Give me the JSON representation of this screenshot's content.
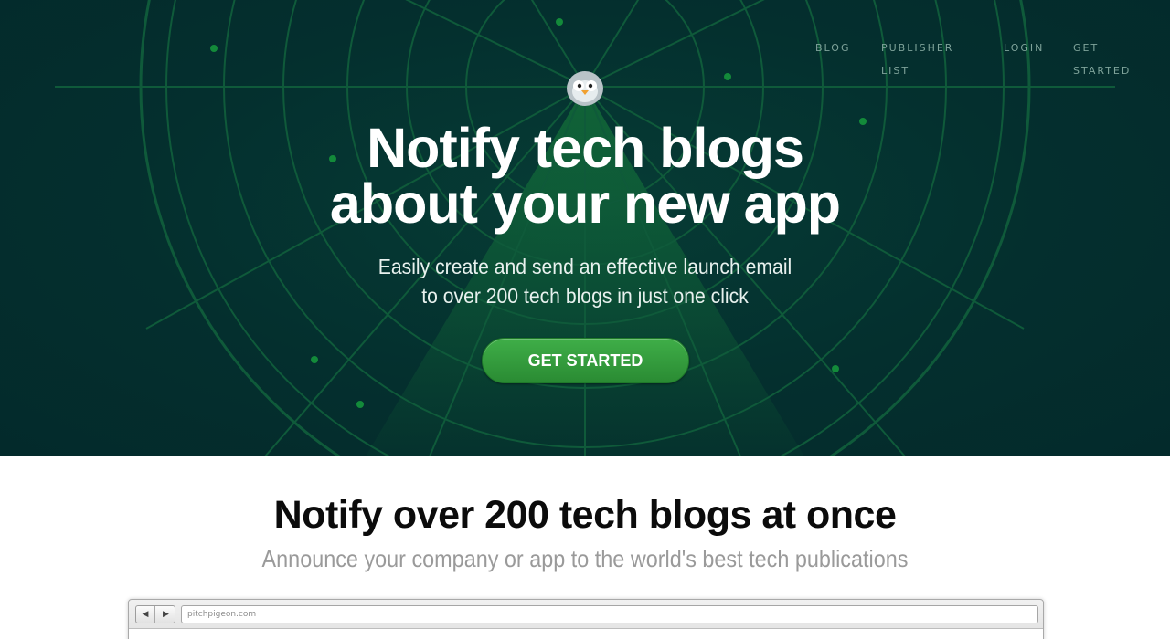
{
  "nav": {
    "blog": "BLOG",
    "publisher_list": "PUBLISHER LIST",
    "login": "LOGIN",
    "get_started": "GET STARTED"
  },
  "hero": {
    "title_line1": "Notify tech blogs",
    "title_line2": "about your new app",
    "subtitle_line1": "Easily create and send an effective launch email",
    "subtitle_line2": "to over 200 tech blogs in just one click",
    "cta_label": "GET STARTED"
  },
  "features": {
    "title": "Notify over 200 tech blogs at once",
    "subtitle": "Announce your company or app to the world's best tech publications"
  },
  "browser_mock": {
    "back_icon": "◀",
    "forward_icon": "▶",
    "url": "pitchpigeon.com"
  },
  "colors": {
    "hero_bg": "#042f2e",
    "radar_line": "#0f5a3a",
    "cta_green": "#35a03e",
    "nav_text": "#7fa39a"
  },
  "icons": {
    "logo": "pigeon-logo-icon",
    "back": "arrow-left-icon",
    "forward": "arrow-right-icon"
  }
}
